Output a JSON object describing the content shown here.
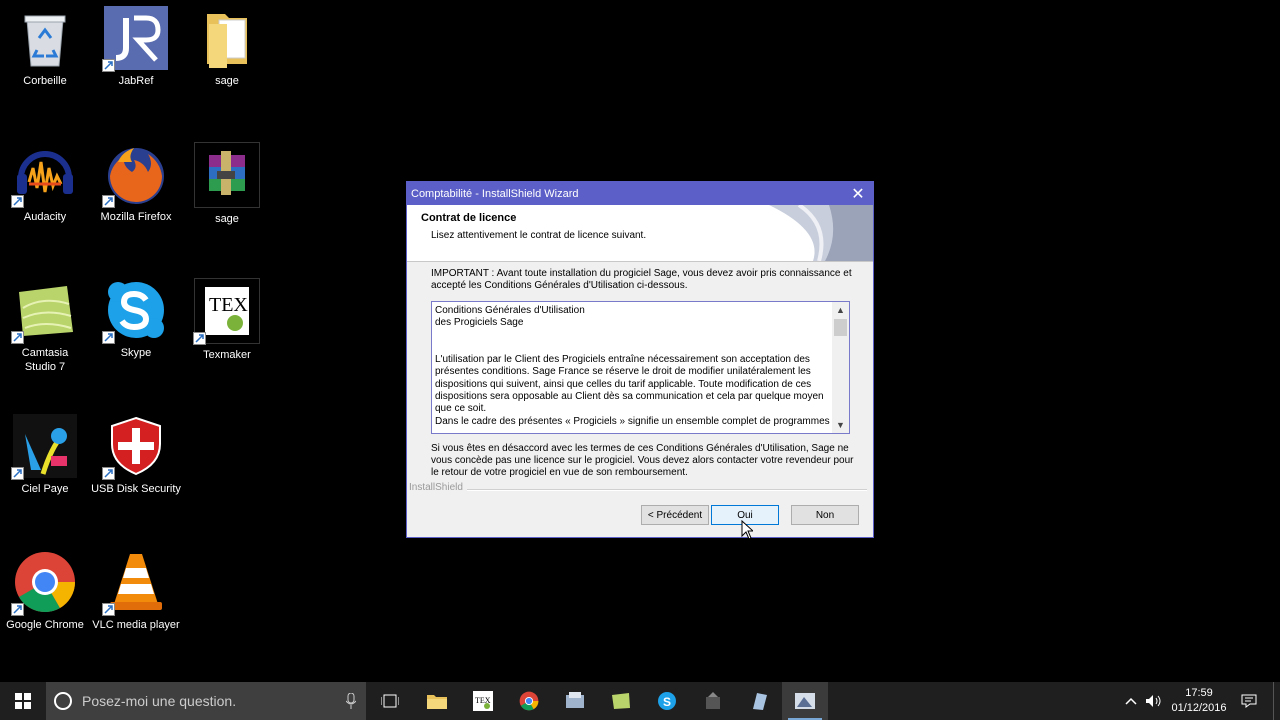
{
  "desktop": {
    "icons": [
      {
        "label": "Corbeille"
      },
      {
        "label": "JabRef"
      },
      {
        "label": "sage"
      },
      {
        "label": "Audacity"
      },
      {
        "label": "Mozilla Firefox"
      },
      {
        "label": "sage"
      },
      {
        "label": "Camtasia\nStudio 7"
      },
      {
        "label": "Skype"
      },
      {
        "label": "Texmaker"
      },
      {
        "label": "Ciel Paye"
      },
      {
        "label": "USB Disk Security"
      },
      {
        "label": "Google Chrome"
      },
      {
        "label": "VLC media player"
      }
    ]
  },
  "dialog": {
    "title": "Comptabilité - InstallShield Wizard",
    "close": "✕",
    "heading": "Contrat de licence",
    "subheading": "Lisez attentivement le contrat de licence suivant.",
    "intro": "IMPORTANT  :  Avant toute installation du progiciel Sage, vous devez avoir pris connaissance et accepté les Conditions Générales d'Utilisation ci-dessous.",
    "license_text": "Conditions Générales d'Utilisation\ndes Progiciels Sage\n\n\nL'utilisation par le Client des Progiciels entraîne nécessairement son acceptation des présentes conditions. Sage France se réserve le droit de modifier unilatéralement les dispositions qui suivent, ainsi que celles du tarif applicable. Toute modification de ces dispositions sera opposable au Client dès sa communication et cela par quelque moyen que ce soit.\nDans le cadre des présentes « Progiciels » signifie un ensemble complet de programmes",
    "disagree": "Si vous êtes en désaccord avec les termes de ces Conditions Générales d'Utilisation, Sage ne vous concède pas une licence sur le progiciel. Vous devez alors contacter votre revendeur pour le retour de votre progiciel en vue de  son remboursement.",
    "brand": "InstallShield",
    "buttons": {
      "back": "< Précédent",
      "yes": "Oui",
      "no": "Non"
    }
  },
  "taskbar": {
    "search_placeholder": "Posez-moi une question.",
    "time": "17:59",
    "date": "01/12/2016"
  },
  "colors": {
    "dialog_titlebar": "#5b5fc7",
    "taskbar": "#1f1f1f",
    "desktop": "#000000"
  }
}
